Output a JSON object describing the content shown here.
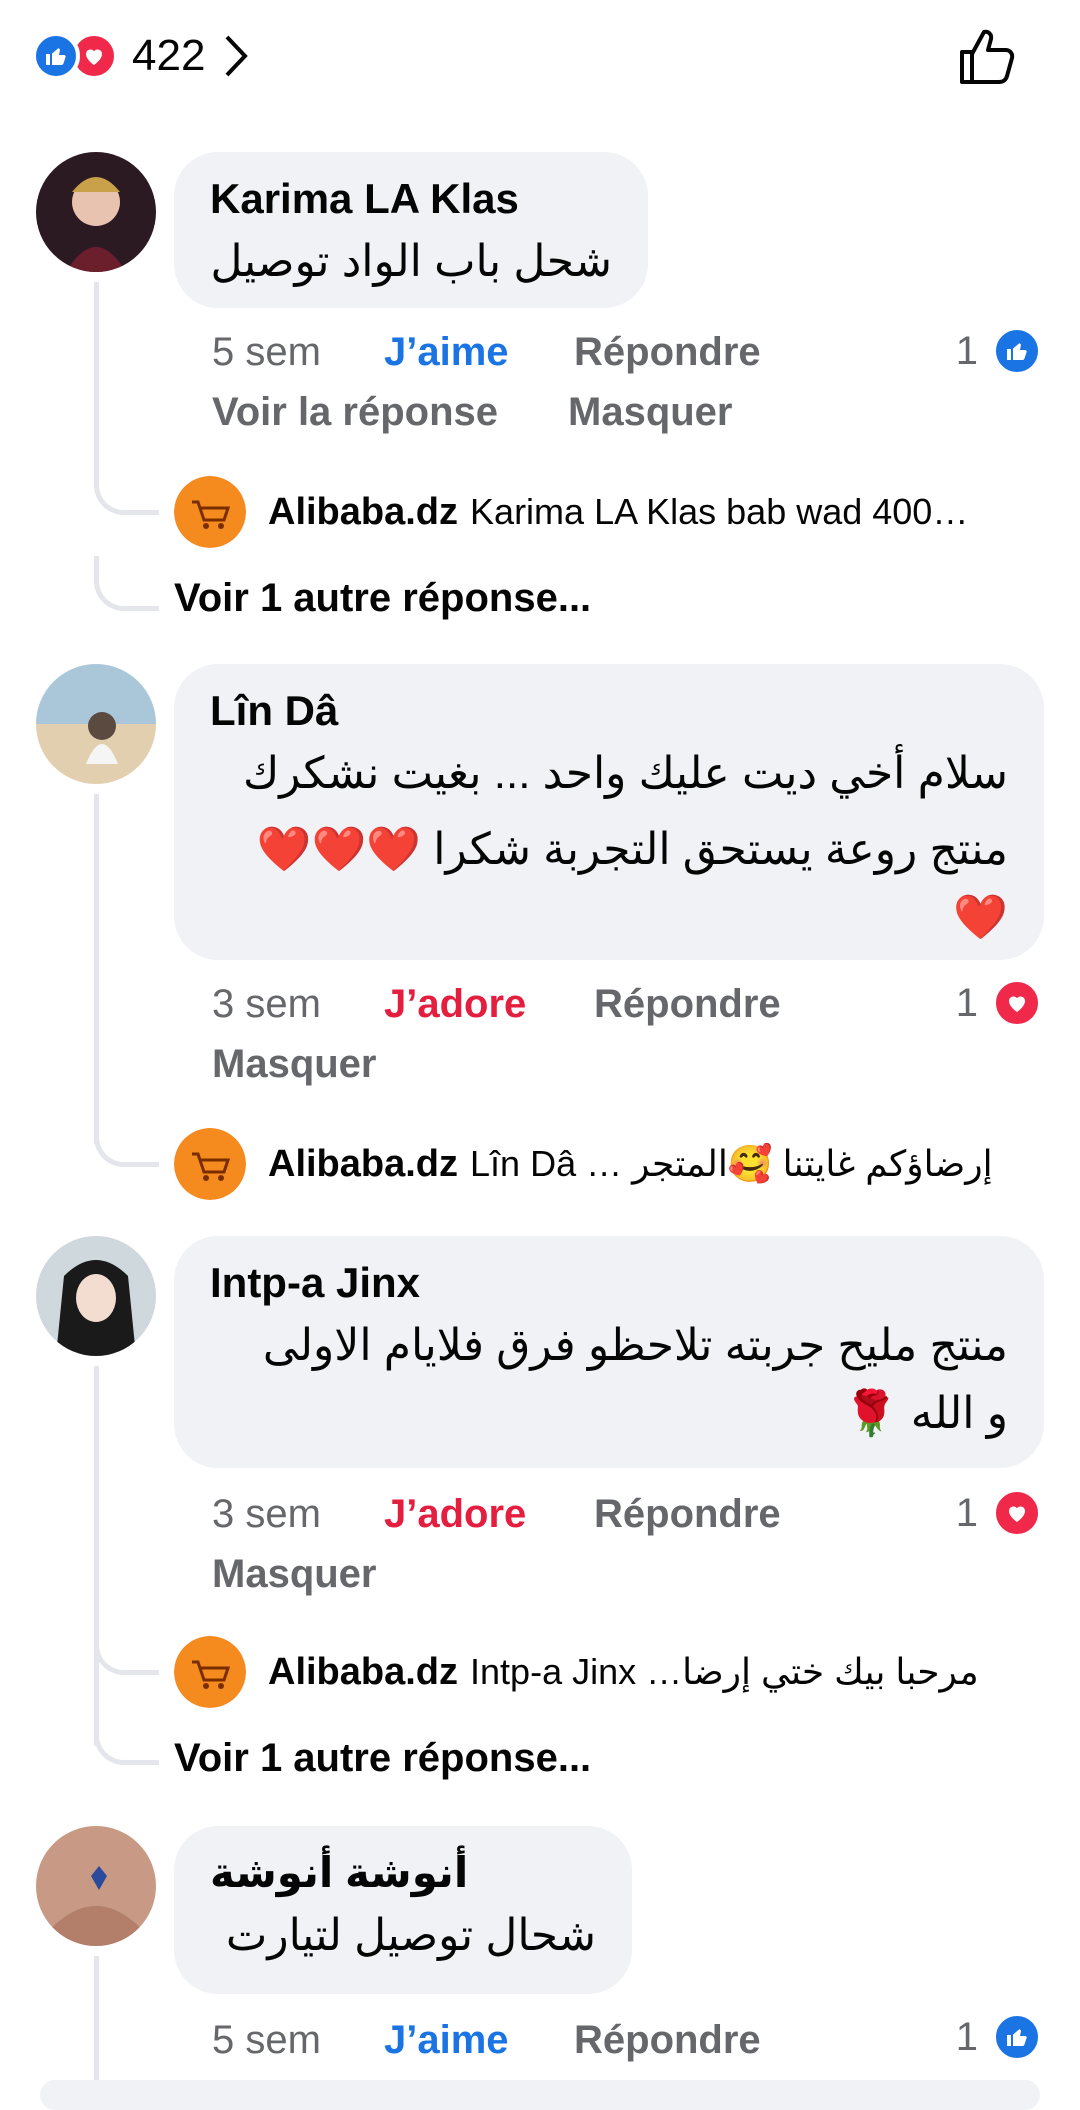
{
  "header": {
    "reaction_count": "422"
  },
  "comments": [
    {
      "author": "Karima LA Klas",
      "text": "شحل باب الواد توصيل",
      "time": "5 sem",
      "reaction_label": "J’aime",
      "reply_label": "Répondre",
      "reaction_count": "1",
      "extra_actions": [
        "Voir la réponse",
        "Masquer"
      ],
      "reply_preview": {
        "author": "Alibaba.dz",
        "text": "Karima LA Klas bab wad 400…"
      },
      "more_replies": "Voir 1 autre réponse..."
    },
    {
      "author": "Lîn Dâ",
      "text_lines": [
        "سلام أخي ديت عليك واحد ... بغيت نشكرك",
        "منتج روعة يستحق التجربة شكرا ❤️❤️❤️",
        "❤️"
      ],
      "time": "3 sem",
      "reaction_label": "J’adore",
      "reply_label": "Répondre",
      "reaction_count": "1",
      "extra_actions": [
        "Masquer"
      ],
      "reply_preview": {
        "author": "Alibaba.dz",
        "text": "Lîn Dâ … إرضاؤكم غايتنا 🥰المتجر"
      }
    },
    {
      "author": "Intp-a Jinx",
      "text_lines": [
        "منتج مليح جربته تلاحظو فرق فلايام الاولى",
        "و الله 🌹"
      ],
      "time": "3 sem",
      "reaction_label": "J’adore",
      "reply_label": "Répondre",
      "reaction_count": "1",
      "extra_actions": [
        "Masquer"
      ],
      "reply_preview": {
        "author": "Alibaba.dz",
        "text": "Intp-a Jinx …مرحبا بيك ختي إرضا"
      },
      "more_replies": "Voir 1 autre réponse..."
    },
    {
      "author": "أنوشة أنوشة",
      "text": "شحال  توصيل لتيارت",
      "time": "5 sem",
      "reaction_label": "J’aime",
      "reply_label": "Répondre",
      "reaction_count": "1"
    }
  ],
  "colors": {
    "like_blue": "#1b74e4",
    "love_red": "#f0284a",
    "bubble_bg": "#f0f2f5",
    "secondary_text": "#65676b"
  }
}
